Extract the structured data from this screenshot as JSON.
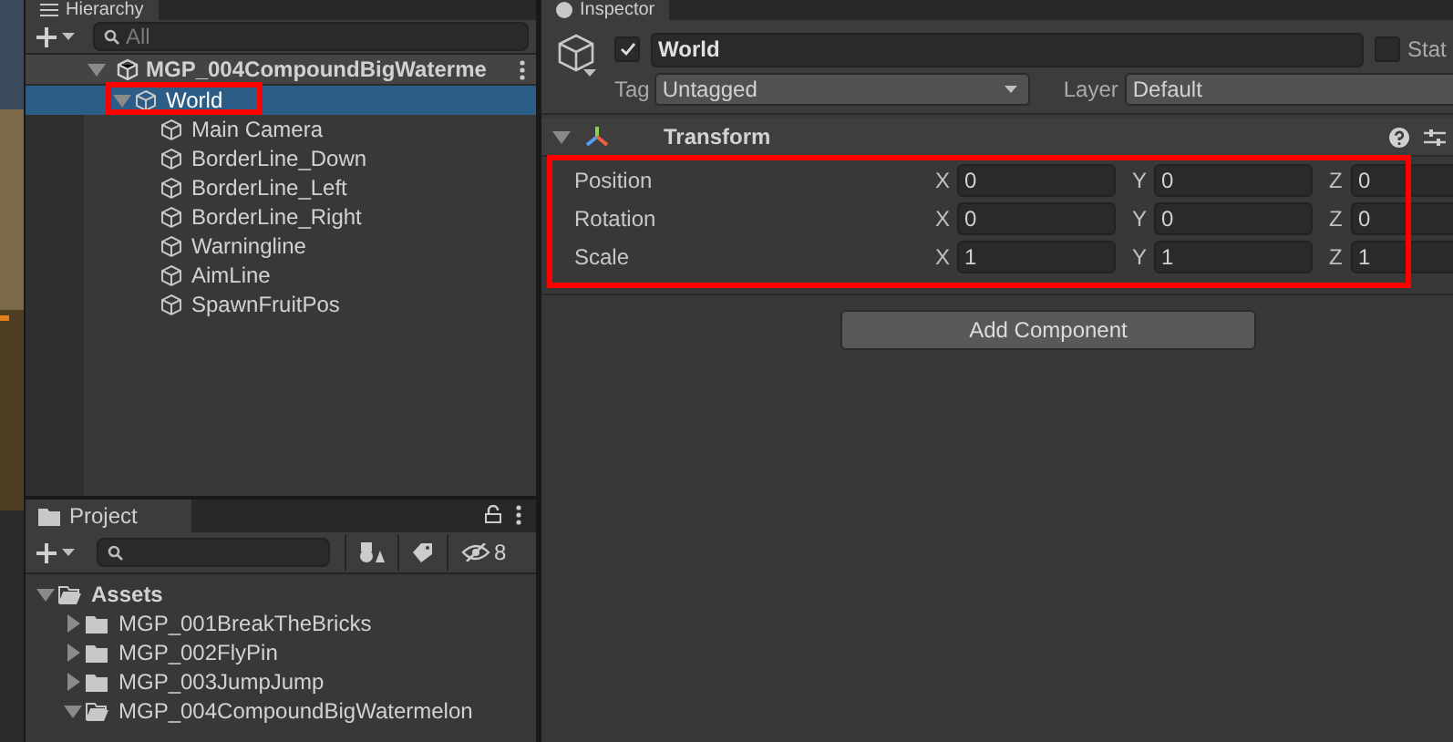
{
  "hierarchy": {
    "tab": "Hierarchy",
    "search": {
      "placeholder": "All"
    },
    "scene": {
      "label": "MGP_004CompoundBigWaterme",
      "expanded": true
    },
    "items": [
      {
        "label": "World",
        "selected": true,
        "expanded": true,
        "highlighted": true,
        "children": [
          {
            "label": "Main Camera",
            "selected": false
          },
          {
            "label": "BorderLine_Down",
            "selected": false
          },
          {
            "label": "BorderLine_Left",
            "selected": false
          },
          {
            "label": "BorderLine_Right",
            "selected": false
          },
          {
            "label": "Warningline",
            "selected": false
          },
          {
            "label": "AimLine",
            "selected": false
          },
          {
            "label": "SpawnFruitPos",
            "selected": false
          }
        ]
      }
    ]
  },
  "project": {
    "tab": "Project",
    "hidden_count": "8",
    "tree": [
      {
        "label": "Assets",
        "expanded": true,
        "children": [
          {
            "label": "MGP_001BreakTheBricks",
            "expanded": false
          },
          {
            "label": "MGP_002FlyPin",
            "expanded": false
          },
          {
            "label": "MGP_003JumpJump",
            "expanded": false
          },
          {
            "label": "MGP_004CompoundBigWatermelon",
            "expanded": true
          }
        ]
      }
    ]
  },
  "inspector": {
    "tab": "Inspector",
    "object": {
      "active": true,
      "name": "World",
      "static_label": "Stat",
      "static": false
    },
    "tag": {
      "label": "Tag",
      "value": "Untagged"
    },
    "layer": {
      "label": "Layer",
      "value": "Default"
    },
    "components": [
      {
        "title": "Transform",
        "expanded": true,
        "highlighted": true,
        "rows": [
          {
            "label": "Position",
            "fields": [
              {
                "axis": "X",
                "value": "0"
              },
              {
                "axis": "Y",
                "value": "0"
              },
              {
                "axis": "Z",
                "value": "0"
              }
            ]
          },
          {
            "label": "Rotation",
            "fields": [
              {
                "axis": "X",
                "value": "0"
              },
              {
                "axis": "Y",
                "value": "0"
              },
              {
                "axis": "Z",
                "value": "0"
              }
            ]
          },
          {
            "label": "Scale",
            "fields": [
              {
                "axis": "X",
                "value": "1"
              },
              {
                "axis": "Y",
                "value": "1"
              },
              {
                "axis": "Z",
                "value": "1"
              }
            ]
          }
        ]
      }
    ],
    "add_button": "Add Component"
  }
}
